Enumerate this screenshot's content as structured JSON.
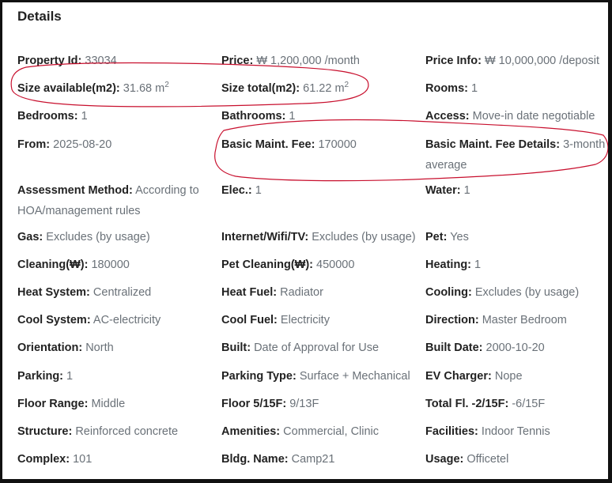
{
  "title": "Details",
  "fields": {
    "property_id": {
      "label": "Property Id:",
      "value": "33034"
    },
    "price": {
      "label": "Price:",
      "value": "₩ 1,200,000 /month"
    },
    "price_info": {
      "label": "Price Info:",
      "value": "₩ 10,000,000 /deposit"
    },
    "size_available": {
      "label": "Size available(m2):",
      "value": "31.68 m",
      "unit_sup": "2"
    },
    "size_total": {
      "label": "Size total(m2):",
      "value": "61.22 m",
      "unit_sup": "2"
    },
    "rooms": {
      "label": "Rooms:",
      "value": "1"
    },
    "bedrooms": {
      "label": "Bedrooms:",
      "value": "1"
    },
    "bathrooms": {
      "label": "Bathrooms:",
      "value": "1"
    },
    "access": {
      "label": "Access:",
      "value": "Move-in date negotiable"
    },
    "from": {
      "label": "From:",
      "value": "2025-08-20"
    },
    "basic_maint_fee": {
      "label": "Basic Maint. Fee:",
      "value": "170000"
    },
    "basic_maint_fee_details": {
      "label": "Basic Maint. Fee Details:",
      "value": "3-month average"
    },
    "assessment_method": {
      "label": "Assessment Method:",
      "value": "According to HOA/management rules"
    },
    "elec": {
      "label": "Elec.:",
      "value": "1"
    },
    "water": {
      "label": "Water:",
      "value": "1"
    },
    "gas": {
      "label": "Gas:",
      "value": "Excludes (by usage)"
    },
    "internet": {
      "label": "Internet/Wifi/TV:",
      "value": "Excludes (by usage)"
    },
    "pet": {
      "label": "Pet:",
      "value": "Yes"
    },
    "cleaning": {
      "label": "Cleaning(₩):",
      "value": "180000"
    },
    "pet_cleaning": {
      "label": "Pet Cleaning(₩):",
      "value": "450000"
    },
    "heating": {
      "label": "Heating:",
      "value": "1"
    },
    "heat_system": {
      "label": "Heat System:",
      "value": "Centralized"
    },
    "heat_fuel": {
      "label": "Heat Fuel:",
      "value": "Radiator"
    },
    "cooling": {
      "label": "Cooling:",
      "value": "Excludes (by usage)"
    },
    "cool_system": {
      "label": "Cool System:",
      "value": "AC-electricity"
    },
    "cool_fuel": {
      "label": "Cool Fuel:",
      "value": "Electricity"
    },
    "direction": {
      "label": "Direction:",
      "value": "Master Bedroom"
    },
    "orientation": {
      "label": "Orientation:",
      "value": "North"
    },
    "built": {
      "label": "Built:",
      "value": "Date of Approval for Use"
    },
    "built_date": {
      "label": "Built Date:",
      "value": "2000-10-20"
    },
    "parking": {
      "label": "Parking:",
      "value": "1"
    },
    "parking_type": {
      "label": "Parking Type:",
      "value": "Surface + Mechanical"
    },
    "ev_charger": {
      "label": "EV Charger:",
      "value": "Nope"
    },
    "floor_range": {
      "label": "Floor Range:",
      "value": "Middle"
    },
    "floor": {
      "label": "Floor 5/15F:",
      "value": "9/13F"
    },
    "total_fl": {
      "label": "Total Fl. -2/15F:",
      "value": "-6/15F"
    },
    "structure": {
      "label": "Structure:",
      "value": "Reinforced concrete"
    },
    "amenities": {
      "label": "Amenities:",
      "value": "Commercial, Clinic"
    },
    "facilities": {
      "label": "Facilities:",
      "value": "Indoor Tennis"
    },
    "complex": {
      "label": "Complex:",
      "value": "101"
    },
    "bldg_name": {
      "label": "Bldg. Name:",
      "value": "Camp21"
    },
    "usage": {
      "label": "Usage:",
      "value": "Officetel"
    }
  },
  "colors": {
    "label": "#222222",
    "value": "#6a7178",
    "annotation": "#c8102e",
    "frame": "#111111"
  }
}
